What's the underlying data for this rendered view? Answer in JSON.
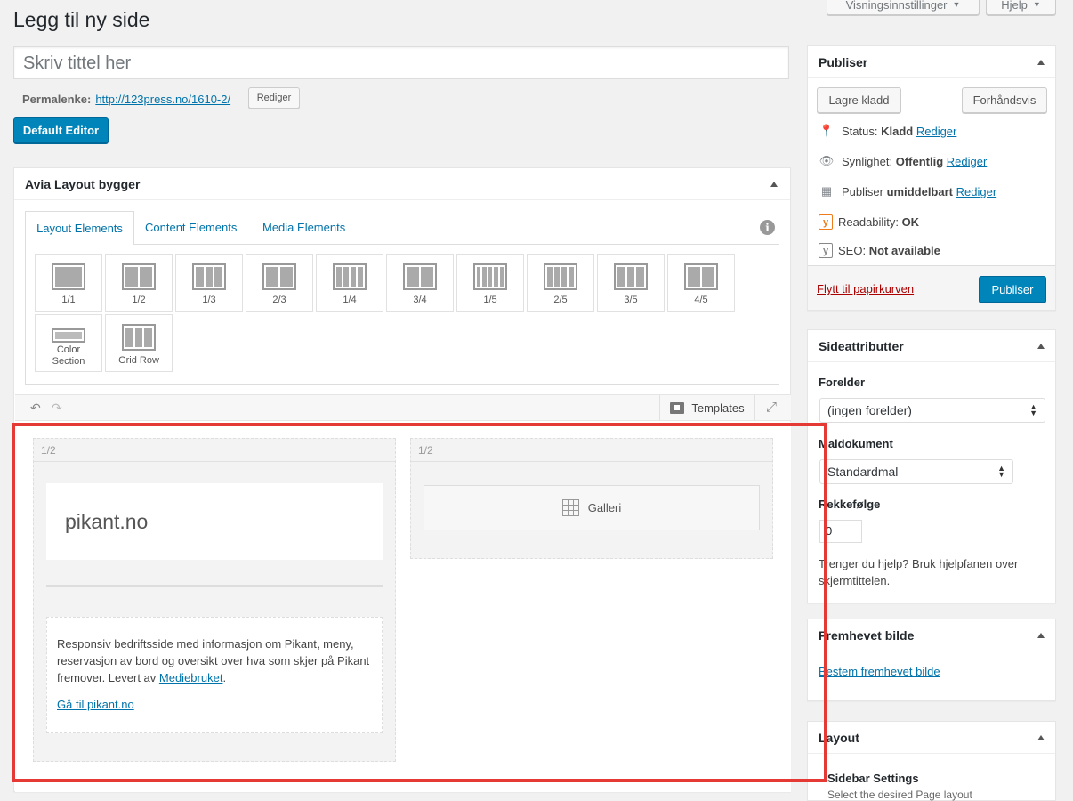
{
  "header": {
    "title": "Legg til ny side",
    "screen_options": "Visningsinnstillinger",
    "help": "Hjelp"
  },
  "title_input": {
    "placeholder": "Skriv tittel her"
  },
  "permalink": {
    "label": "Permalenke:",
    "url": "http://123press.no/1610-2/",
    "edit": "Rediger"
  },
  "default_editor_button": "Default Editor",
  "builder": {
    "title": "Avia Layout bygger",
    "tabs": [
      {
        "label": "Layout Elements"
      },
      {
        "label": "Content Elements"
      },
      {
        "label": "Media Elements"
      }
    ],
    "elements": [
      {
        "label": "1/1",
        "cols": 1
      },
      {
        "label": "1/2",
        "cols": 2
      },
      {
        "label": "1/3",
        "cols": 3
      },
      {
        "label": "2/3",
        "cols": 2
      },
      {
        "label": "1/4",
        "cols": 4
      },
      {
        "label": "3/4",
        "cols": 2
      },
      {
        "label": "1/5",
        "cols": 5
      },
      {
        "label": "2/5",
        "cols": 4
      },
      {
        "label": "3/5",
        "cols": 3
      },
      {
        "label": "4/5",
        "cols": 2
      },
      {
        "label": "Color Section",
        "cols": 1
      },
      {
        "label": "Grid Row",
        "cols": 3
      }
    ],
    "templates_label": "Templates",
    "columns": [
      {
        "size": "1/2",
        "heading_text": "pikant.no",
        "text": "Responsiv bedriftsside med informasjon om Pikant, meny, reservasjon av bord og oversikt over hva som skjer på Pikant fremover. Levert av ",
        "text_link": "Mediebruket",
        "text_end": ".",
        "link": "Gå til pikant.no"
      },
      {
        "size": "1/2",
        "gallery_label": "Galleri"
      }
    ]
  },
  "publish": {
    "title": "Publiser",
    "save_draft": "Lagre kladd",
    "preview": "Forhåndsvis",
    "status_label": "Status:",
    "status_value": "Kladd",
    "visibility_label": "Synlighet:",
    "visibility_value": "Offentlig",
    "publish_label": "Publiser",
    "publish_value": "umiddelbart",
    "edit": "Rediger",
    "readability_label": "Readability:",
    "readability_value": "OK",
    "seo_label": "SEO:",
    "seo_value": "Not available",
    "trash": "Flytt til papirkurven",
    "publish_button": "Publiser"
  },
  "page_attributes": {
    "title": "Sideattributter",
    "parent_label": "Forelder",
    "parent_value": "(ingen forelder)",
    "template_label": "Maldokument",
    "template_value": "Standardmal",
    "order_label": "Rekkefølge",
    "order_value": "0",
    "help_text": "Trenger du hjelp? Bruk hjelpfanen over skjermtittelen."
  },
  "featured_image": {
    "title": "Fremhevet bilde",
    "link": "Bestem fremhevet bilde"
  },
  "layout_box": {
    "title": "Layout",
    "sidebar_settings": "Sidebar Settings",
    "sidebar_desc": "Select the desired Page layout"
  },
  "colors": {
    "accent": "#0085ba",
    "link": "#0073aa",
    "highlight": "#e53935",
    "trash": "#a00"
  }
}
